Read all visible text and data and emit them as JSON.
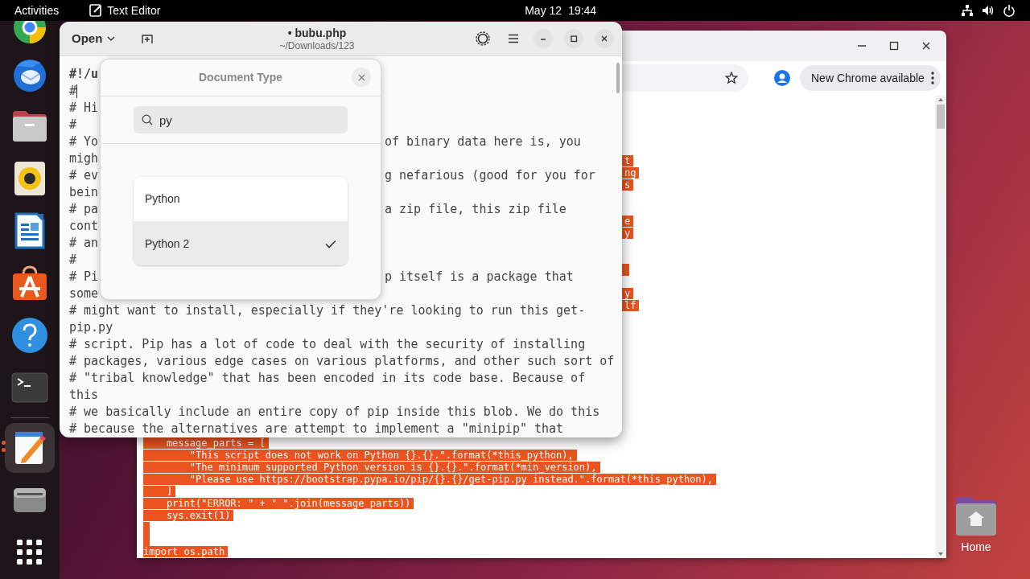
{
  "top_bar": {
    "activities": "Activities",
    "app_name": "Text Editor",
    "date": "May 12",
    "time": "19:44"
  },
  "dock": {
    "items": [
      {
        "kind": "browser",
        "active": false
      },
      {
        "kind": "mail",
        "active": false
      },
      {
        "kind": "files",
        "active": false
      },
      {
        "kind": "music",
        "active": false
      },
      {
        "kind": "writer",
        "active": false
      },
      {
        "kind": "software",
        "active": false
      },
      {
        "kind": "help",
        "active": false
      },
      {
        "kind": "terminal",
        "active": false
      },
      {
        "kind": "separator",
        "active": false
      },
      {
        "kind": "text_editor",
        "active": true
      },
      {
        "kind": "drive",
        "active": false
      },
      {
        "kind": "app_grid",
        "active": false
      }
    ]
  },
  "editor": {
    "open_label": "Open",
    "title": "• bubu.php",
    "subtitle": "~/Downloads/123",
    "lines": [
      {
        "left": "#!/u",
        "bold": true,
        "cursor": false
      },
      {
        "left": "#",
        "bold": false,
        "cursor": true
      },
      {
        "left": "# Hi",
        "bold": false,
        "cursor": false
      },
      {
        "left": "#",
        "bold": false,
        "cursor": false
      },
      {
        "left": "# Yo",
        "right": "of binary data here is, you",
        "bold": false,
        "cursor": false
      },
      {
        "left": "migh",
        "bold": false,
        "cursor": false
      },
      {
        "left": "# ev",
        "right": "g nefarious (good for you for",
        "bold": false,
        "cursor": false
      },
      {
        "left": "bein",
        "bold": false,
        "cursor": false
      },
      {
        "left": "# pa",
        "right": "a zip file, this zip file",
        "bold": false,
        "cursor": false
      },
      {
        "left": "cont",
        "bold": false,
        "cursor": false
      },
      {
        "left": "# an",
        "bold": false,
        "cursor": false
      },
      {
        "left": "#",
        "bold": false,
        "cursor": false
      },
      {
        "left": "# Pi",
        "right": "p itself is a package that",
        "bold": false,
        "cursor": false
      },
      {
        "left": "some",
        "bold": false,
        "cursor": false
      },
      {
        "left": "# might want to install, especially if they're looking to run this get-",
        "bold": false,
        "cursor": false
      },
      {
        "left": "pip.py",
        "bold": false,
        "cursor": false
      },
      {
        "left": "# script. Pip has a lot of code to deal with the security of installing",
        "bold": false,
        "cursor": false
      },
      {
        "left": "# packages, various edge cases on various platforms, and other such sort of",
        "bold": false,
        "cursor": false
      },
      {
        "left": "# \"tribal knowledge\" that has been encoded in its code base. Because of",
        "bold": false,
        "cursor": false
      },
      {
        "left": "this",
        "bold": false,
        "cursor": false
      },
      {
        "left": "# we basically include an entire copy of pip inside this blob. We do this",
        "bold": false,
        "cursor": false
      },
      {
        "left": "# because the alternatives are attempt to implement a \"minipip\" that",
        "bold": false,
        "cursor": false
      }
    ]
  },
  "document_type_popover": {
    "title": "Document Type",
    "search": {
      "value": "py"
    },
    "options": [
      {
        "label": "Python",
        "selected": false
      },
      {
        "label": "Python 2",
        "selected": true
      }
    ]
  },
  "chrome": {
    "update_button": "New Chrome available",
    "page_fragments": [
      {
        "kind": "text",
        "text": "t"
      },
      {
        "kind": "text",
        "text": "ng"
      },
      {
        "kind": "text",
        "text": "s"
      },
      {
        "kind": "gap"
      },
      {
        "kind": "gap"
      },
      {
        "kind": "text",
        "text": "e"
      },
      {
        "kind": "text",
        "text": "y"
      },
      {
        "kind": "gap"
      },
      {
        "kind": "gap"
      },
      {
        "kind": "blank"
      },
      {
        "kind": "gap"
      },
      {
        "kind": "text",
        "text": "y"
      },
      {
        "kind": "text",
        "text": "lf"
      }
    ],
    "code_lines": [
      {
        "kind": "text",
        "text": "    message_parts = ["
      },
      {
        "kind": "text",
        "text": "        \"This script does not work on Python {}.{}.\".format(*this_python),"
      },
      {
        "kind": "text",
        "text": "        \"The minimum supported Python version is {}.{}.\".format(*min_version),"
      },
      {
        "kind": "text",
        "text": "        \"Please use https://bootstrap.pypa.io/pip/{}.{}/get-pip.py instead.\".format(*this_python),"
      },
      {
        "kind": "text",
        "text": "    ]"
      },
      {
        "kind": "text",
        "text": "    print(\"ERROR: \" + \" \".join(message_parts))"
      },
      {
        "kind": "text",
        "text": "    sys.exit(1)"
      },
      {
        "kind": "blank"
      },
      {
        "kind": "blank"
      },
      {
        "kind": "text",
        "text": "import os.path"
      }
    ]
  },
  "desktop": {
    "home_label": "Home"
  }
}
